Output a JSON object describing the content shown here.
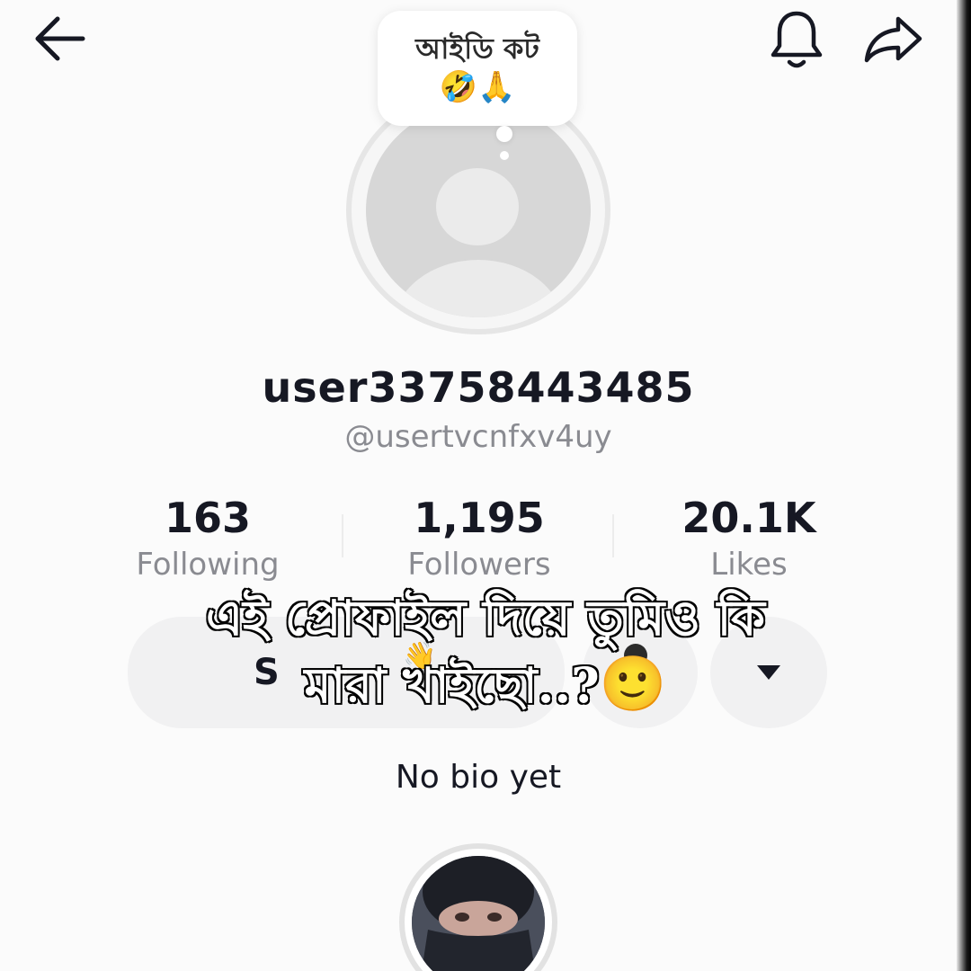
{
  "header": {
    "back_icon": "arrow-left-icon",
    "bell_icon": "bell-icon",
    "share_icon": "share-arrow-icon"
  },
  "note": {
    "text": "আইডি কট",
    "emoji": "🤣🙏"
  },
  "profile": {
    "display_name": "user33758443485",
    "handle": "@usertvcnfxv4uy",
    "bio": "No bio yet"
  },
  "stats": {
    "following": {
      "value": "163",
      "label": "Following"
    },
    "followers": {
      "value": "1,195",
      "label": "Followers"
    },
    "likes": {
      "value": "20.1K",
      "label": "Likes"
    }
  },
  "actions": {
    "send_label": "S",
    "send_emoji": "👋",
    "more_icon": "triangle-down-icon"
  },
  "overlay": {
    "line1": "এই প্রোফাইল দিয়ে তুমিও কি",
    "line2": "মারা খাইছো..?",
    "emoji": "🙂"
  },
  "colors": {
    "text_primary": "#161823",
    "text_secondary": "#8a8b91",
    "button_bg": "#f1f1f2"
  }
}
